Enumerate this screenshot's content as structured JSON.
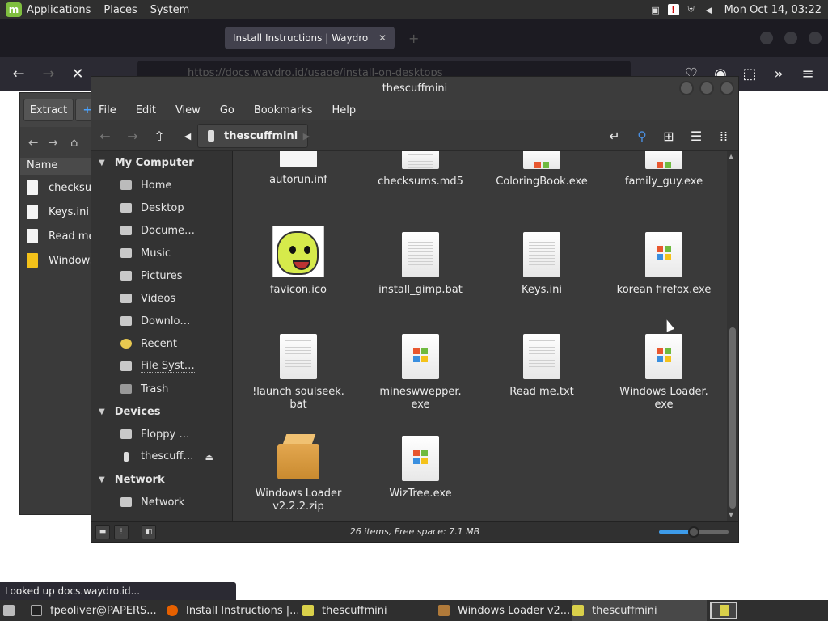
{
  "top_panel": {
    "menus": [
      "Applications",
      "Places",
      "System"
    ],
    "clock": "Mon Oct 14, 03:22"
  },
  "browser": {
    "tab_active": "Install Instructions | Waydro",
    "tab_inactive": "",
    "url": "https://docs.waydro.id/usage/install-on-desktops",
    "status": "Looked up docs.waydro.id..."
  },
  "archive": {
    "extract_label": "Extract",
    "column_name": "Name",
    "rows": [
      "checksur",
      "Keys.ini",
      "Read me",
      "Windows"
    ]
  },
  "caja": {
    "title": "thescuffmini",
    "menu": [
      "File",
      "Edit",
      "View",
      "Go",
      "Bookmarks",
      "Help"
    ],
    "path": "thescuffmini",
    "sidebar": {
      "my_computer": "My Computer",
      "places": [
        "Home",
        "Desktop",
        "Docume…",
        "Music",
        "Pictures",
        "Videos",
        "Downlo…",
        "Recent",
        "File Syst…",
        "Trash"
      ],
      "devices": "Devices",
      "device_items": [
        "Floppy …",
        "thescuff…"
      ],
      "network": "Network",
      "network_items": [
        "Network"
      ]
    },
    "files": [
      {
        "name": "autorun.inf",
        "type": "blank"
      },
      {
        "name": "checksums.md5",
        "type": "doc"
      },
      {
        "name": "ColoringBook.exe",
        "type": "exe"
      },
      {
        "name": "family_guy.exe",
        "type": "exe"
      },
      {
        "name": "favicon.ico",
        "type": "img"
      },
      {
        "name": "install_gimp.bat",
        "type": "doc"
      },
      {
        "name": "Keys.ini",
        "type": "doc"
      },
      {
        "name": "korean firefox.exe",
        "type": "exe"
      },
      {
        "name": "!launch soulseek.\nbat",
        "type": "doc"
      },
      {
        "name": "mineswwepper.\nexe",
        "type": "exe"
      },
      {
        "name": "Read me.txt",
        "type": "doc"
      },
      {
        "name": "Windows Loader.\nexe",
        "type": "exe"
      },
      {
        "name": "Windows Loader\nv2.2.2.zip",
        "type": "zip"
      },
      {
        "name": "WizTree.exe",
        "type": "exe"
      }
    ],
    "status": "26 items, Free space: 7.1 MB",
    "zoom_level": 0.5
  },
  "taskbar": {
    "tasks": [
      "fpeoliver@PAPERS...",
      "Install Instructions |...",
      "thescuffmini",
      "Windows Loader v2....",
      "thescuffmini"
    ]
  }
}
